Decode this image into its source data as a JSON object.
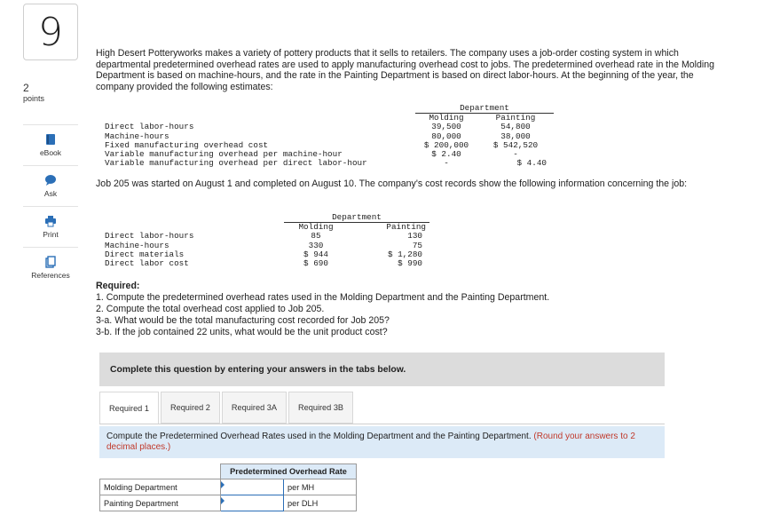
{
  "question": {
    "number": "9",
    "points": "2",
    "points_label": "points"
  },
  "rail": [
    {
      "label": "eBook",
      "icon": "ebook-icon"
    },
    {
      "label": "Ask",
      "icon": "ask-icon"
    },
    {
      "label": "Print",
      "icon": "print-icon"
    },
    {
      "label": "References",
      "icon": "references-icon"
    }
  ],
  "intro": "High Desert Potteryworks makes a variety of pottery products that it sells to retailers. The company uses a job-order costing system in which departmental predetermined overhead rates are used to apply manufacturing overhead cost to jobs. The predetermined overhead rate in the Molding Department is based on machine-hours, and the rate in the Painting Department is based on direct labor-hours. At the beginning of the year, the company provided the following estimates:",
  "estimates": {
    "department_header": "Department",
    "molding_header": "Molding",
    "painting_header": "Painting",
    "rows": [
      {
        "label": "Direct labor-hours",
        "molding": "39,500",
        "painting": "54,800"
      },
      {
        "label": "Machine-hours",
        "molding": "80,000",
        "painting": "38,000"
      },
      {
        "label": "Fixed manufacturing overhead cost",
        "molding": "$ 200,000",
        "painting": "$ 542,520"
      },
      {
        "label": "Variable manufacturing overhead per machine-hour",
        "molding": "$ 2.40",
        "painting": "-"
      },
      {
        "label": "Variable manufacturing overhead per direct labor-hour",
        "molding": "-",
        "painting": "$ 4.40"
      }
    ]
  },
  "job_text": "Job 205 was started on August 1 and completed on August 10. The company's cost records show the following information concerning the job:",
  "job": {
    "department_header": "Department",
    "molding_header": "Molding",
    "painting_header": "Painting",
    "rows": [
      {
        "label": "Direct labor-hours",
        "molding": "85",
        "painting": "130"
      },
      {
        "label": "Machine-hours",
        "molding": "330",
        "painting": "75"
      },
      {
        "label": "Direct materials",
        "molding": "$ 944",
        "painting": "$ 1,280"
      },
      {
        "label": "Direct labor cost",
        "molding": "$ 690",
        "painting": "$ 990"
      }
    ]
  },
  "required": {
    "title": "Required:",
    "items": [
      "1. Compute the predetermined overhead rates used in the Molding Department and the Painting Department.",
      "2. Compute the total overhead cost applied to Job 205.",
      "3-a. What would be the total manufacturing cost recorded for Job 205?",
      "3-b. If the job contained 22 units, what would be the unit product cost?"
    ]
  },
  "complete_bar": "Complete this question by entering your answers in the tabs below.",
  "tabs": [
    "Required 1",
    "Required 2",
    "Required 3A",
    "Required 3B"
  ],
  "instruction": {
    "text": "Compute the Predetermined Overhead Rates used in the Molding Department and the Painting Department.",
    "note": "(Round your answers to 2 decimal places.)"
  },
  "answer_table": {
    "header": "Predetermined Overhead Rate",
    "rows": [
      {
        "label": "Molding Department",
        "value": "",
        "unit": "per MH"
      },
      {
        "label": "Painting Department",
        "value": "",
        "unit": "per DLH"
      }
    ]
  },
  "colors": {
    "accent_blue": "#2b6fb7",
    "light_blue": "#dceaf7",
    "gray_bar": "#dcdcdc",
    "note_red": "#c0392b"
  }
}
